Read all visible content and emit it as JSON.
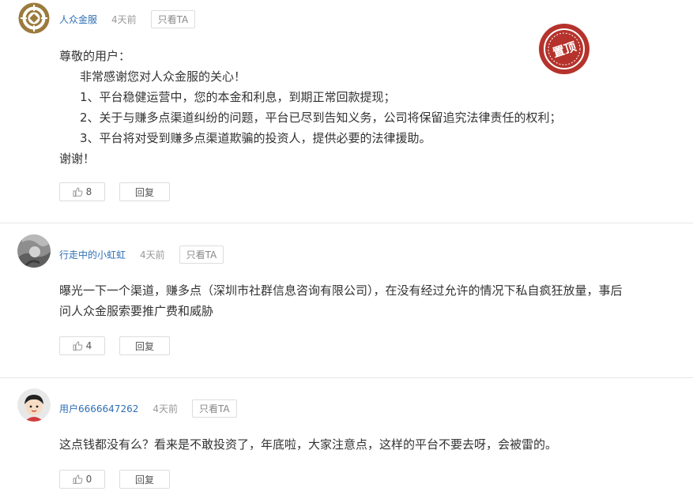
{
  "colors": {
    "username": "#2e6fb5",
    "stamp": "#b5332c",
    "divider": "#e6e6e6"
  },
  "posts": [
    {
      "username": "人众金服",
      "time": "4天前",
      "only_ta": "只看TA",
      "stamp_label": "置顶",
      "avatar_icon": "coin-logo-icon",
      "lines": [
        "尊敬的用户：",
        "非常感谢您对人众金服的关心！",
        "1、平台稳健运营中，您的本金和利息，到期正常回款提现；",
        "2、关于与赚多点渠道纠纷的问题，平台已尽到告知义务，公司将保留追究法律责任的权利；",
        "3、平台将对受到赚多点渠道欺骗的投资人，提供必要的法律援助。",
        "谢谢！"
      ],
      "likes": "8",
      "reply": "回复"
    },
    {
      "username": "行走中的小虹虹",
      "time": "4天前",
      "only_ta": "只看TA",
      "avatar_icon": "photo-avatar",
      "lines": [
        "曝光一下一个渠道，赚多点（深圳市社群信息咨询有限公司），在没有经过允许的情况下私自疯狂放量，事后",
        "问人众金服索要推广费和威胁"
      ],
      "likes": "4",
      "reply": "回复"
    },
    {
      "username": "用户6666647262",
      "time": "4天前",
      "only_ta": "只看TA",
      "avatar_icon": "cartoon-avatar",
      "lines": [
        "这点钱都没有么？看来是不敢投资了，年底啦，大家注意点，这样的平台不要去呀，会被雷的。"
      ],
      "likes": "0",
      "reply": "回复"
    }
  ]
}
